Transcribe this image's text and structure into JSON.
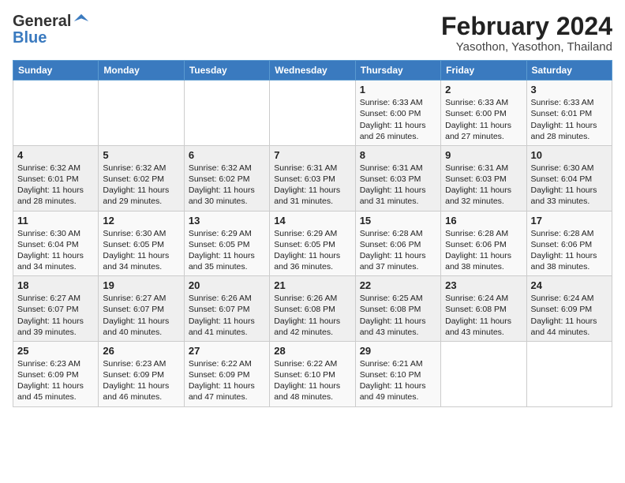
{
  "header": {
    "logo_general": "General",
    "logo_blue": "Blue",
    "title": "February 2024",
    "subtitle": "Yasothon, Yasothon, Thailand"
  },
  "weekdays": [
    "Sunday",
    "Monday",
    "Tuesday",
    "Wednesday",
    "Thursday",
    "Friday",
    "Saturday"
  ],
  "weeks": [
    [
      {
        "day": "",
        "sunrise": "",
        "sunset": "",
        "daylight": ""
      },
      {
        "day": "",
        "sunrise": "",
        "sunset": "",
        "daylight": ""
      },
      {
        "day": "",
        "sunrise": "",
        "sunset": "",
        "daylight": ""
      },
      {
        "day": "",
        "sunrise": "",
        "sunset": "",
        "daylight": ""
      },
      {
        "day": "1",
        "sunrise": "Sunrise: 6:33 AM",
        "sunset": "Sunset: 6:00 PM",
        "daylight": "Daylight: 11 hours and 26 minutes."
      },
      {
        "day": "2",
        "sunrise": "Sunrise: 6:33 AM",
        "sunset": "Sunset: 6:00 PM",
        "daylight": "Daylight: 11 hours and 27 minutes."
      },
      {
        "day": "3",
        "sunrise": "Sunrise: 6:33 AM",
        "sunset": "Sunset: 6:01 PM",
        "daylight": "Daylight: 11 hours and 28 minutes."
      }
    ],
    [
      {
        "day": "4",
        "sunrise": "Sunrise: 6:32 AM",
        "sunset": "Sunset: 6:01 PM",
        "daylight": "Daylight: 11 hours and 28 minutes."
      },
      {
        "day": "5",
        "sunrise": "Sunrise: 6:32 AM",
        "sunset": "Sunset: 6:02 PM",
        "daylight": "Daylight: 11 hours and 29 minutes."
      },
      {
        "day": "6",
        "sunrise": "Sunrise: 6:32 AM",
        "sunset": "Sunset: 6:02 PM",
        "daylight": "Daylight: 11 hours and 30 minutes."
      },
      {
        "day": "7",
        "sunrise": "Sunrise: 6:31 AM",
        "sunset": "Sunset: 6:03 PM",
        "daylight": "Daylight: 11 hours and 31 minutes."
      },
      {
        "day": "8",
        "sunrise": "Sunrise: 6:31 AM",
        "sunset": "Sunset: 6:03 PM",
        "daylight": "Daylight: 11 hours and 31 minutes."
      },
      {
        "day": "9",
        "sunrise": "Sunrise: 6:31 AM",
        "sunset": "Sunset: 6:03 PM",
        "daylight": "Daylight: 11 hours and 32 minutes."
      },
      {
        "day": "10",
        "sunrise": "Sunrise: 6:30 AM",
        "sunset": "Sunset: 6:04 PM",
        "daylight": "Daylight: 11 hours and 33 minutes."
      }
    ],
    [
      {
        "day": "11",
        "sunrise": "Sunrise: 6:30 AM",
        "sunset": "Sunset: 6:04 PM",
        "daylight": "Daylight: 11 hours and 34 minutes."
      },
      {
        "day": "12",
        "sunrise": "Sunrise: 6:30 AM",
        "sunset": "Sunset: 6:05 PM",
        "daylight": "Daylight: 11 hours and 34 minutes."
      },
      {
        "day": "13",
        "sunrise": "Sunrise: 6:29 AM",
        "sunset": "Sunset: 6:05 PM",
        "daylight": "Daylight: 11 hours and 35 minutes."
      },
      {
        "day": "14",
        "sunrise": "Sunrise: 6:29 AM",
        "sunset": "Sunset: 6:05 PM",
        "daylight": "Daylight: 11 hours and 36 minutes."
      },
      {
        "day": "15",
        "sunrise": "Sunrise: 6:28 AM",
        "sunset": "Sunset: 6:06 PM",
        "daylight": "Daylight: 11 hours and 37 minutes."
      },
      {
        "day": "16",
        "sunrise": "Sunrise: 6:28 AM",
        "sunset": "Sunset: 6:06 PM",
        "daylight": "Daylight: 11 hours and 38 minutes."
      },
      {
        "day": "17",
        "sunrise": "Sunrise: 6:28 AM",
        "sunset": "Sunset: 6:06 PM",
        "daylight": "Daylight: 11 hours and 38 minutes."
      }
    ],
    [
      {
        "day": "18",
        "sunrise": "Sunrise: 6:27 AM",
        "sunset": "Sunset: 6:07 PM",
        "daylight": "Daylight: 11 hours and 39 minutes."
      },
      {
        "day": "19",
        "sunrise": "Sunrise: 6:27 AM",
        "sunset": "Sunset: 6:07 PM",
        "daylight": "Daylight: 11 hours and 40 minutes."
      },
      {
        "day": "20",
        "sunrise": "Sunrise: 6:26 AM",
        "sunset": "Sunset: 6:07 PM",
        "daylight": "Daylight: 11 hours and 41 minutes."
      },
      {
        "day": "21",
        "sunrise": "Sunrise: 6:26 AM",
        "sunset": "Sunset: 6:08 PM",
        "daylight": "Daylight: 11 hours and 42 minutes."
      },
      {
        "day": "22",
        "sunrise": "Sunrise: 6:25 AM",
        "sunset": "Sunset: 6:08 PM",
        "daylight": "Daylight: 11 hours and 43 minutes."
      },
      {
        "day": "23",
        "sunrise": "Sunrise: 6:24 AM",
        "sunset": "Sunset: 6:08 PM",
        "daylight": "Daylight: 11 hours and 43 minutes."
      },
      {
        "day": "24",
        "sunrise": "Sunrise: 6:24 AM",
        "sunset": "Sunset: 6:09 PM",
        "daylight": "Daylight: 11 hours and 44 minutes."
      }
    ],
    [
      {
        "day": "25",
        "sunrise": "Sunrise: 6:23 AM",
        "sunset": "Sunset: 6:09 PM",
        "daylight": "Daylight: 11 hours and 45 minutes."
      },
      {
        "day": "26",
        "sunrise": "Sunrise: 6:23 AM",
        "sunset": "Sunset: 6:09 PM",
        "daylight": "Daylight: 11 hours and 46 minutes."
      },
      {
        "day": "27",
        "sunrise": "Sunrise: 6:22 AM",
        "sunset": "Sunset: 6:09 PM",
        "daylight": "Daylight: 11 hours and 47 minutes."
      },
      {
        "day": "28",
        "sunrise": "Sunrise: 6:22 AM",
        "sunset": "Sunset: 6:10 PM",
        "daylight": "Daylight: 11 hours and 48 minutes."
      },
      {
        "day": "29",
        "sunrise": "Sunrise: 6:21 AM",
        "sunset": "Sunset: 6:10 PM",
        "daylight": "Daylight: 11 hours and 49 minutes."
      },
      {
        "day": "",
        "sunrise": "",
        "sunset": "",
        "daylight": ""
      },
      {
        "day": "",
        "sunrise": "",
        "sunset": "",
        "daylight": ""
      }
    ]
  ]
}
